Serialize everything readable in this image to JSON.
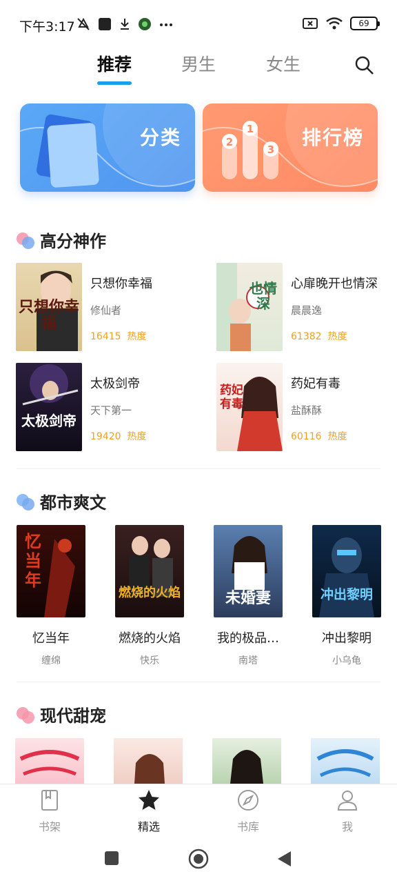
{
  "status": {
    "time": "下午3:17",
    "battery": "69"
  },
  "top_tabs": [
    {
      "label": "推荐",
      "active": true
    },
    {
      "label": "男生",
      "active": false
    },
    {
      "label": "女生",
      "active": false
    }
  ],
  "banners": {
    "category": "分类",
    "ranking": "排行榜"
  },
  "section1": {
    "title": "高分神作",
    "books": [
      {
        "title": "只想你幸福",
        "author": "修仙者",
        "heat": "16415",
        "heat_label": "热度",
        "cover_text": "只想你幸福"
      },
      {
        "title": "心扉晚开也情深",
        "author": "晨晨逸",
        "heat": "61382",
        "heat_label": "热度",
        "cover_text": "也情深"
      },
      {
        "title": "太极剑帝",
        "author": "天下第一",
        "heat": "19420",
        "heat_label": "热度",
        "cover_text": "太极剑帝"
      },
      {
        "title": "药妃有毒",
        "author": "盐酥酥",
        "heat": "60116",
        "heat_label": "热度",
        "cover_text": "药妃有毒"
      }
    ]
  },
  "section2": {
    "title": "都市爽文",
    "books": [
      {
        "title": "忆当年",
        "author": "缠绵",
        "cover_text": "忆当年"
      },
      {
        "title": "燃烧的火焰",
        "author": "快乐",
        "cover_text": "燃烧的火焰"
      },
      {
        "title": "我的极品…",
        "author": "南塔",
        "cover_text": "未婚妻"
      },
      {
        "title": "冲出黎明",
        "author": "小乌龟",
        "cover_text": "冲出黎明"
      }
    ]
  },
  "section3": {
    "title": "现代甜宠"
  },
  "bottom_nav": [
    {
      "label": "书架",
      "icon": "bookshelf-icon",
      "active": false
    },
    {
      "label": "精选",
      "icon": "star-icon",
      "active": true
    },
    {
      "label": "书库",
      "icon": "compass-icon",
      "active": false
    },
    {
      "label": "我",
      "icon": "user-icon",
      "active": false
    }
  ],
  "colors": {
    "accent": "#1aa0e8",
    "heat": "#f0a020",
    "banner_blue": "#5aa8f6",
    "banner_orange": "#ff9a72"
  }
}
